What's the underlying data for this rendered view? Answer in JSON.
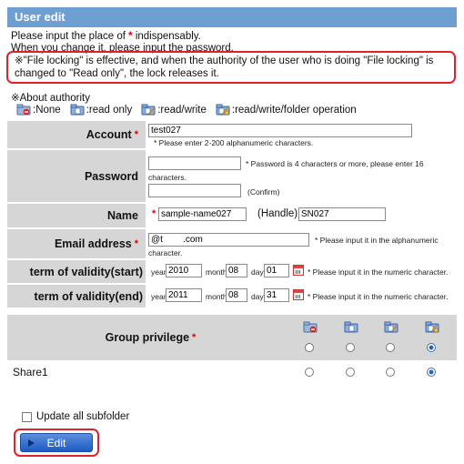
{
  "header": {
    "title": "User edit"
  },
  "intro": {
    "line1_a": "Please input the place of ",
    "line1_star": "*",
    "line1_b": " indispensably.",
    "line2": "When you change it, please input the password."
  },
  "notice": "※\"File locking\" is effective, and when the authority of the user who is doing \"File locking\" is changed to \"Read only\", the lock releases it.",
  "about": {
    "title": "※About authority",
    "legend": [
      {
        "icon": "folder-none-icon",
        "label": ":None"
      },
      {
        "icon": "folder-read-icon",
        "label": ":read only"
      },
      {
        "icon": "folder-read-write-icon",
        "label": ":read/write"
      },
      {
        "icon": "folder-full-icon",
        "label": ":read/write/folder operation"
      }
    ]
  },
  "form": {
    "account": {
      "label": "Account",
      "star": "*",
      "value": "test027",
      "hint": "* Please enter 2-200 alphanumeric characters."
    },
    "password": {
      "label": "Password",
      "hint1": "* Password is 4 characters or more, please enter 16",
      "hint2": "characters.",
      "confirm": "(Confirm)"
    },
    "name": {
      "label": "Name",
      "star": "*",
      "value": "sample-name027",
      "handle_label": "(Handle)",
      "handle_value": "SN027"
    },
    "email": {
      "label": "Email address",
      "star": "*",
      "value": "@t        .com",
      "hint1": "* Please input it in the alphanumeric",
      "hint2": "character."
    },
    "start": {
      "label": "term of validity(start)",
      "year_l": "year",
      "year": "2010",
      "month_l": "month",
      "month": "08",
      "day_l": "day",
      "day": "01",
      "hint": "* Please input it in the numeric character."
    },
    "end": {
      "label": "term of validity(end)",
      "year_l": "year",
      "year": "2011",
      "month_l": "month",
      "month": "08",
      "day_l": "day",
      "day": "31",
      "hint": "* Please input it in the numeric character."
    }
  },
  "privilege": {
    "title": "Group privilege",
    "star": "*",
    "header_selected": 3,
    "share": {
      "name": "Share1",
      "selected": 3
    }
  },
  "footer": {
    "update_subfolder": "Update all subfolder",
    "update_checked": false,
    "edit_label": "Edit"
  }
}
